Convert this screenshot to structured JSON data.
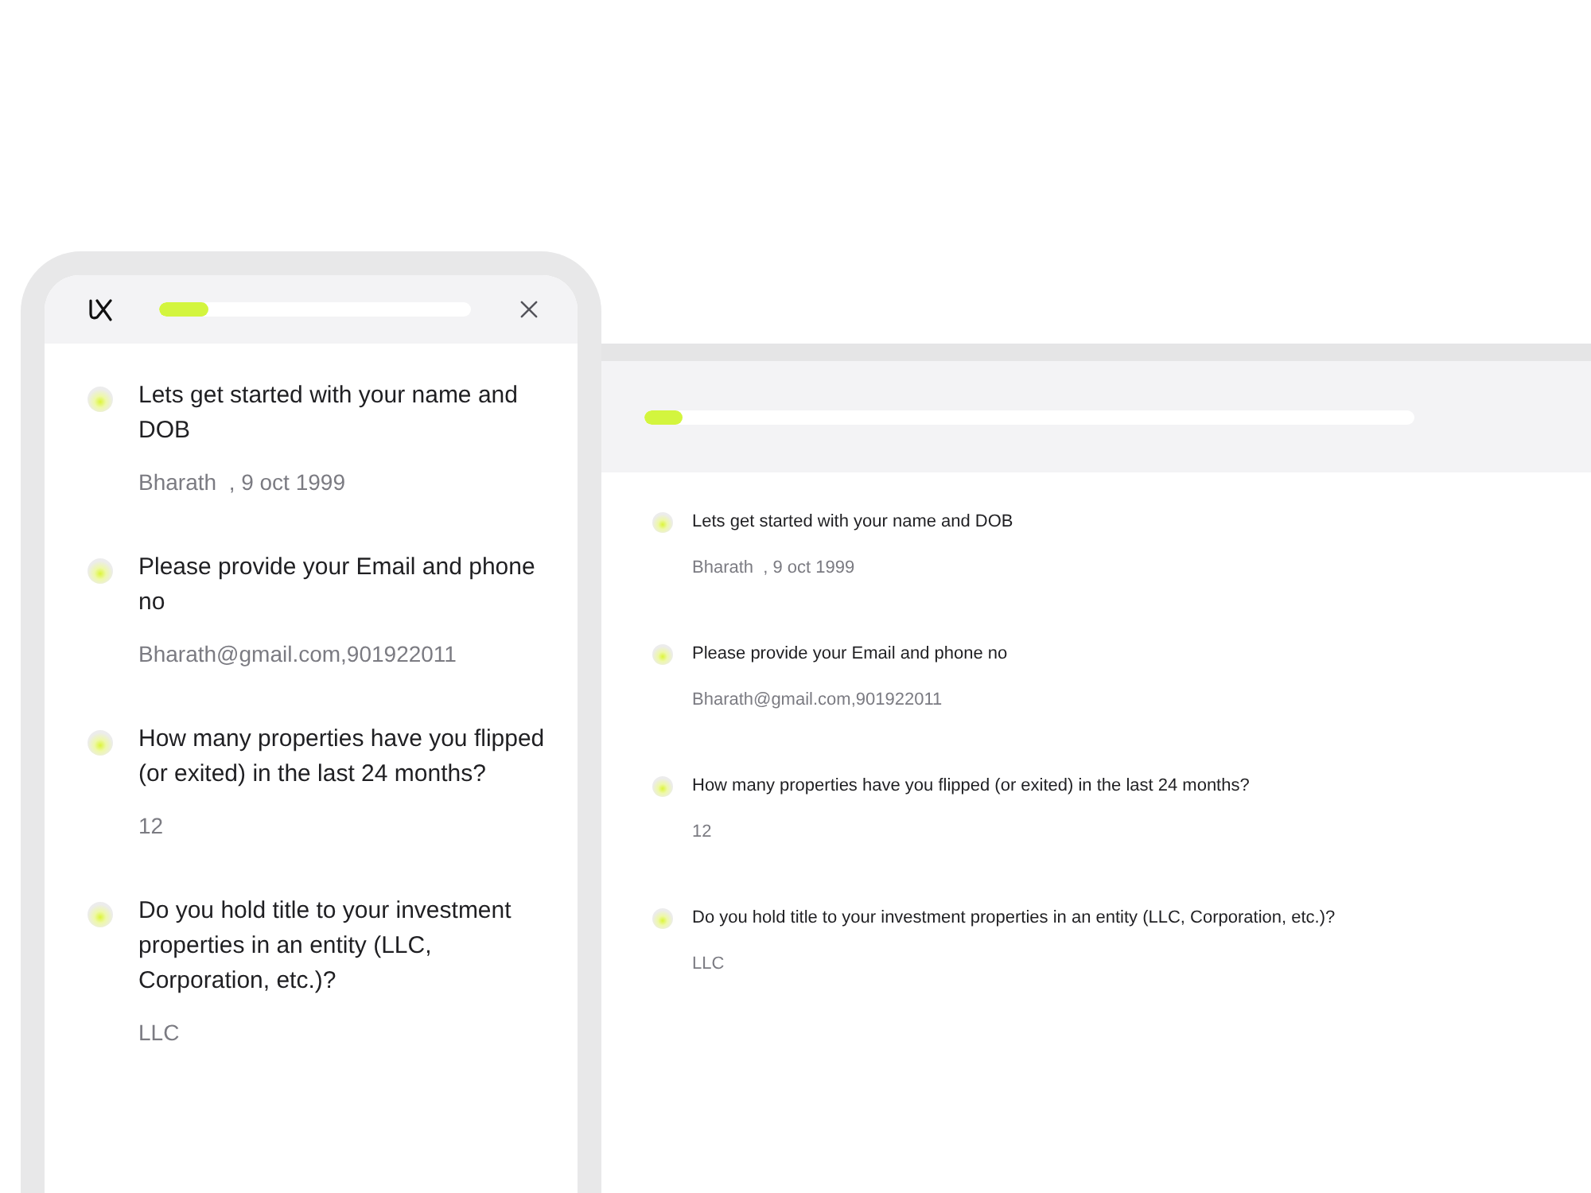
{
  "mobile": {
    "progress": {
      "level": 0.16
    },
    "questions": [
      {
        "question": "Lets get started with your name and DOB",
        "answer": "Bharath  , 9 oct 1999"
      },
      {
        "question": "Please provide your Email and phone no",
        "answer": "Bharath@gmail.com,901922011"
      },
      {
        "question": "How many properties have you flipped (or exited) in the last 24 months?",
        "answer": "12"
      },
      {
        "question": "Do you hold title to your investment properties in an entity (LLC, Corporation, etc.)?",
        "answer": "LLC"
      }
    ]
  },
  "desktop": {
    "progress": {
      "level": 0.05
    },
    "questions": [
      {
        "question": "Lets get started with your name and DOB",
        "answer": "Bharath  , 9 oct 1999"
      },
      {
        "question": "Please provide your Email and phone no",
        "answer": "Bharath@gmail.com,901922011"
      },
      {
        "question": "How many properties have you flipped (or exited) in the last 24 months?",
        "answer": "12"
      },
      {
        "question": "Do you hold title to your investment properties in an entity (LLC, Corporation, etc.)?",
        "answer": "LLC"
      }
    ]
  }
}
